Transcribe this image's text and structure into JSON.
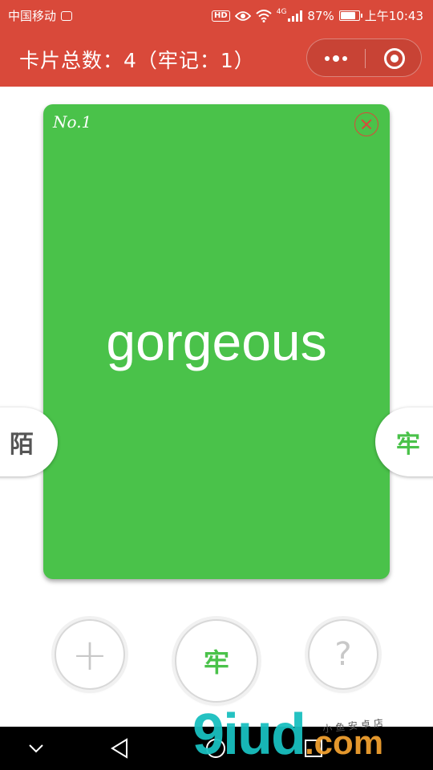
{
  "status_bar": {
    "carrier": "中国移动",
    "hd": "HD",
    "network": "4G",
    "battery_level": "87%",
    "battery_fraction": 0.87,
    "time": "上午10:43"
  },
  "title_bar": {
    "title": "卡片总数：4（牢记：1）"
  },
  "card": {
    "number": "No.1",
    "word": "gorgeous",
    "color": "#4ac24a"
  },
  "side_tabs": {
    "left_label": "陌",
    "right_label": "牢"
  },
  "actions": {
    "add_label": "+",
    "remember_label": "牢",
    "help_label": "?"
  },
  "watermark": {
    "main": "9iud",
    "suffix": ".com",
    "small": "小鱼安卓店"
  },
  "colors": {
    "header": "#d9493a",
    "accent_green": "#4ac24a"
  }
}
